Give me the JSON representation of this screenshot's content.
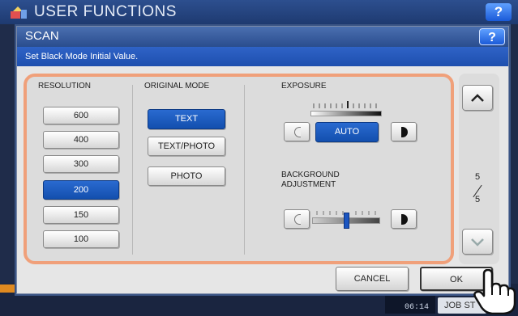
{
  "background_window": {
    "title": "USER FUNCTIONS",
    "help_label": "?",
    "clock_time": "06:14",
    "job_status_label": "JOB ST"
  },
  "dialog": {
    "title": "SCAN",
    "help_label": "?",
    "message": "Set Black Mode Initial Value."
  },
  "resolution": {
    "header": "RESOLUTION",
    "options": [
      "600",
      "400",
      "300",
      "200",
      "150",
      "100"
    ],
    "selected": "200"
  },
  "original_mode": {
    "header": "ORIGINAL MODE",
    "options": [
      "TEXT",
      "TEXT/PHOTO",
      "PHOTO"
    ],
    "selected": "TEXT"
  },
  "exposure": {
    "header": "EXPOSURE",
    "auto_label": "AUTO",
    "auto_selected": true
  },
  "background_adjustment": {
    "label_line1": "BACKGROUND",
    "label_line2": "ADJUSTMENT",
    "level_fraction": 0.5
  },
  "pager": {
    "current": "5",
    "total": "5"
  },
  "actions": {
    "cancel_label": "CANCEL",
    "ok_label": "OK"
  },
  "colors": {
    "selected_button": "#1b55c0",
    "panel_outline": "#f0a07a",
    "title_bar": "#2a4d8e"
  }
}
